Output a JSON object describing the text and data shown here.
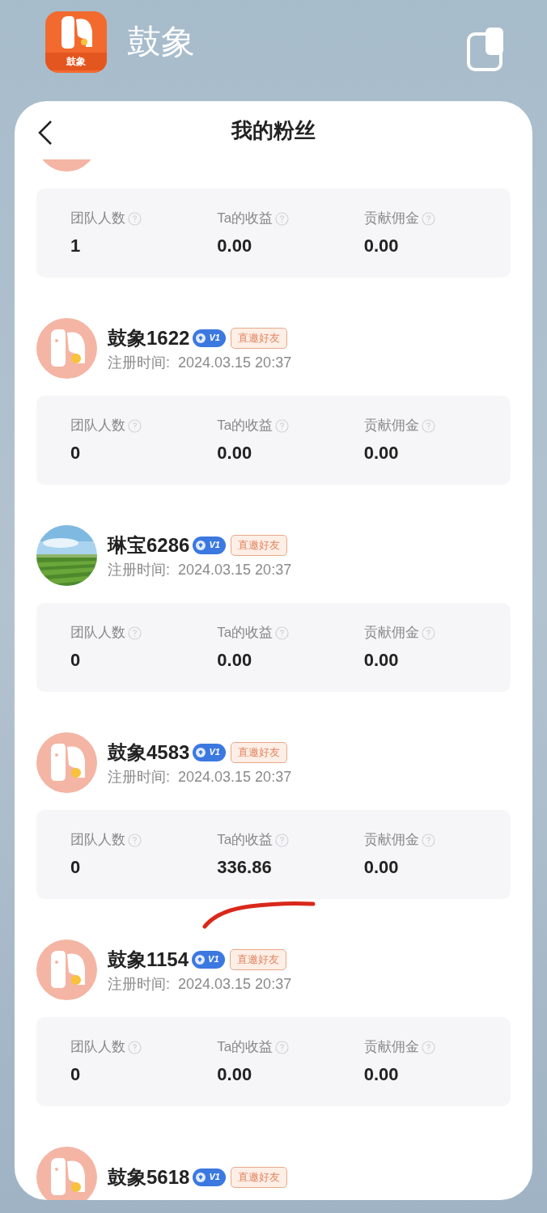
{
  "app": {
    "title": "鼓象",
    "icon_label": "鼓象"
  },
  "window": {
    "title": "我的粉丝"
  },
  "fans": [
    {
      "kind": "elephant",
      "stats": [
        {
          "label": "团队人数",
          "value": "1"
        },
        {
          "label": "Ta的收益",
          "value": "0.00"
        },
        {
          "label": "贡献佣金",
          "value": "0.00"
        }
      ]
    },
    {
      "kind": "elephant",
      "name": "鼓象1622",
      "level": "V1",
      "tag": "直邀好友",
      "time_label": "注册时间:",
      "time": "2024.03.15 20:37",
      "stats": [
        {
          "label": "团队人数",
          "value": "0"
        },
        {
          "label": "Ta的收益",
          "value": "0.00"
        },
        {
          "label": "贡献佣金",
          "value": "0.00"
        }
      ]
    },
    {
      "kind": "picture",
      "name": "琳宝6286",
      "level": "V1",
      "tag": "直邀好友",
      "time_label": "注册时间:",
      "time": "2024.03.15 20:37",
      "stats": [
        {
          "label": "团队人数",
          "value": "0"
        },
        {
          "label": "Ta的收益",
          "value": "0.00"
        },
        {
          "label": "贡献佣金",
          "value": "0.00"
        }
      ]
    },
    {
      "kind": "elephant",
      "name": "鼓象4583",
      "level": "V1",
      "tag": "直邀好友",
      "time_label": "注册时间:",
      "time": "2024.03.15 20:37",
      "stats": [
        {
          "label": "团队人数",
          "value": "0"
        },
        {
          "label": "Ta的收益",
          "value": "336.86"
        },
        {
          "label": "贡献佣金",
          "value": "0.00"
        }
      ]
    },
    {
      "kind": "elephant",
      "name": "鼓象1154",
      "level": "V1",
      "tag": "直邀好友",
      "time_label": "注册时间:",
      "time": "2024.03.15 20:37",
      "annotated": true,
      "stats": [
        {
          "label": "团队人数",
          "value": "0"
        },
        {
          "label": "Ta的收益",
          "value": "0.00"
        },
        {
          "label": "贡献佣金",
          "value": "0.00"
        }
      ]
    },
    {
      "kind": "elephant",
      "name": "鼓象5618",
      "level": "V1",
      "tag": "直邀好友"
    }
  ]
}
